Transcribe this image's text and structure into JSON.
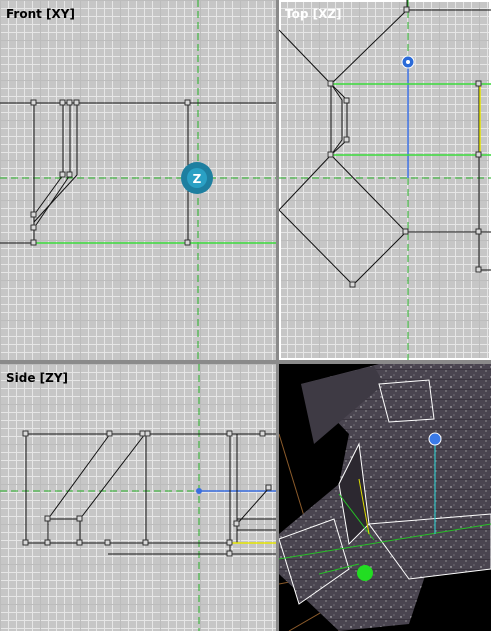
{
  "viewports": {
    "front": {
      "label": "Front [XY]"
    },
    "top": {
      "label": "Top [XZ]"
    },
    "side": {
      "label": "Side [ZY]"
    },
    "perspective": {
      "label": ""
    }
  },
  "gizmo": {
    "label": "Z"
  },
  "colors": {
    "grid_bg": "#c6c6c6",
    "axis_green": "#26b026",
    "axis_blue": "#3a6fe0",
    "selection_yellow": "#e6e600",
    "gizmo_teal": "#1e7fa0"
  }
}
